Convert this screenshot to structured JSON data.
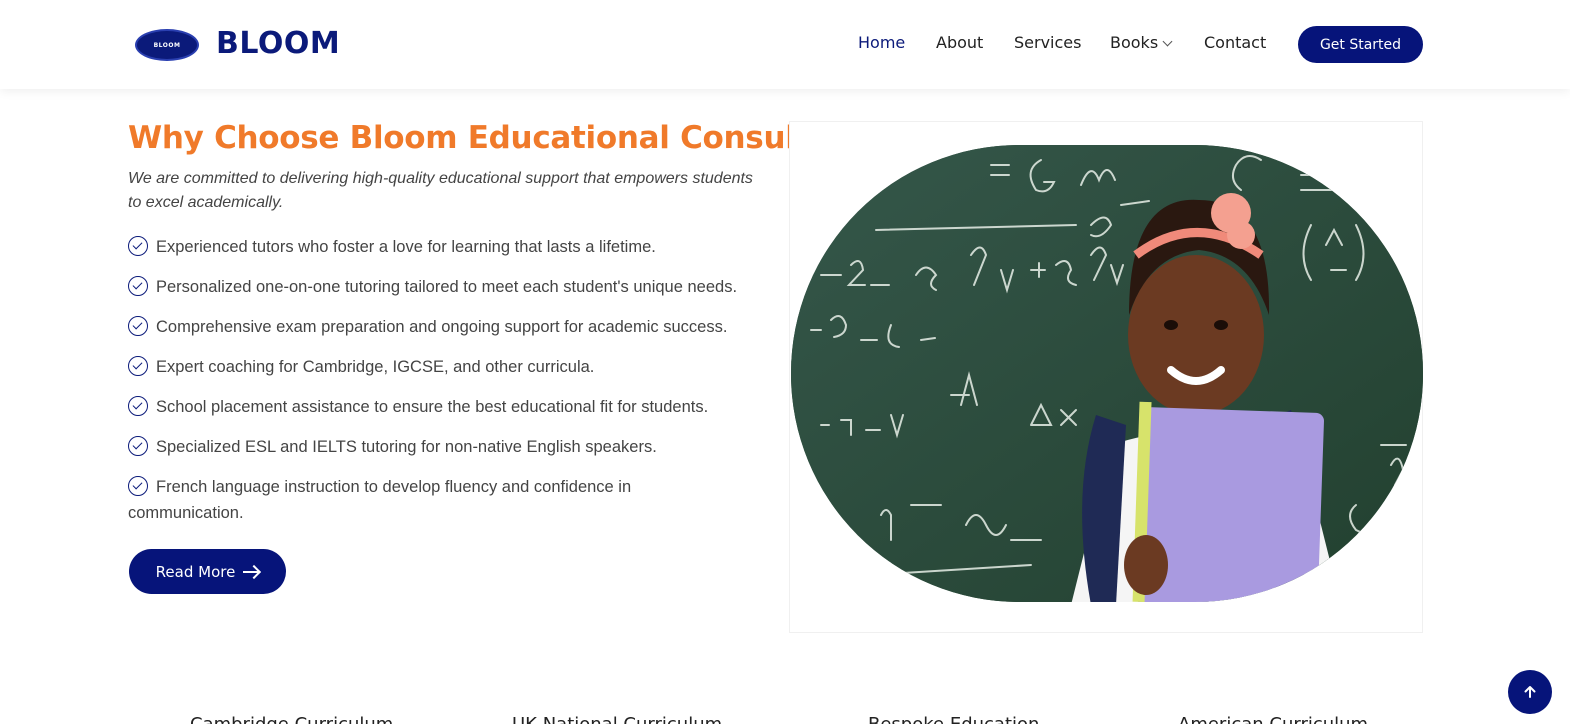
{
  "brand": {
    "name": "BLOOM",
    "logo_text": "BLOOM"
  },
  "nav": {
    "items": [
      {
        "label": "Home",
        "active": true
      },
      {
        "label": "About"
      },
      {
        "label": "Services"
      },
      {
        "label": "Books",
        "dropdown": true
      },
      {
        "label": "Contact"
      }
    ],
    "cta_label": "Get Started"
  },
  "section": {
    "title": "Why Choose Bloom Educational Consult?",
    "subtitle": "We are committed to delivering high-quality educational support that empowers students to excel academically.",
    "points": [
      "Experienced tutors who foster a love for learning that lasts a lifetime.",
      "Personalized one-on-one tutoring tailored to meet each student's unique needs.",
      "Comprehensive exam preparation and ongoing support for academic success.",
      "Expert coaching for Cambridge, IGCSE, and other curricula.",
      "School placement assistance to ensure the best educational fit for students.",
      "Specialized ESL and IELTS tutoring for non-native English speakers.",
      "French language instruction to develop fluency and confidence in communication."
    ],
    "read_more_label": "Read More"
  },
  "bottom_partial": [
    "Cambridge Curriculum",
    "UK National Curriculum",
    "Bespoke Education",
    "American Curriculum"
  ],
  "colors": {
    "primary": "#06147a",
    "accent": "#f07a2a"
  },
  "icons": {
    "check": "check-circle-icon",
    "arrow": "arrow-right-icon",
    "scroll_top": "arrow-up-icon",
    "chevron": "chevron-down-icon"
  }
}
